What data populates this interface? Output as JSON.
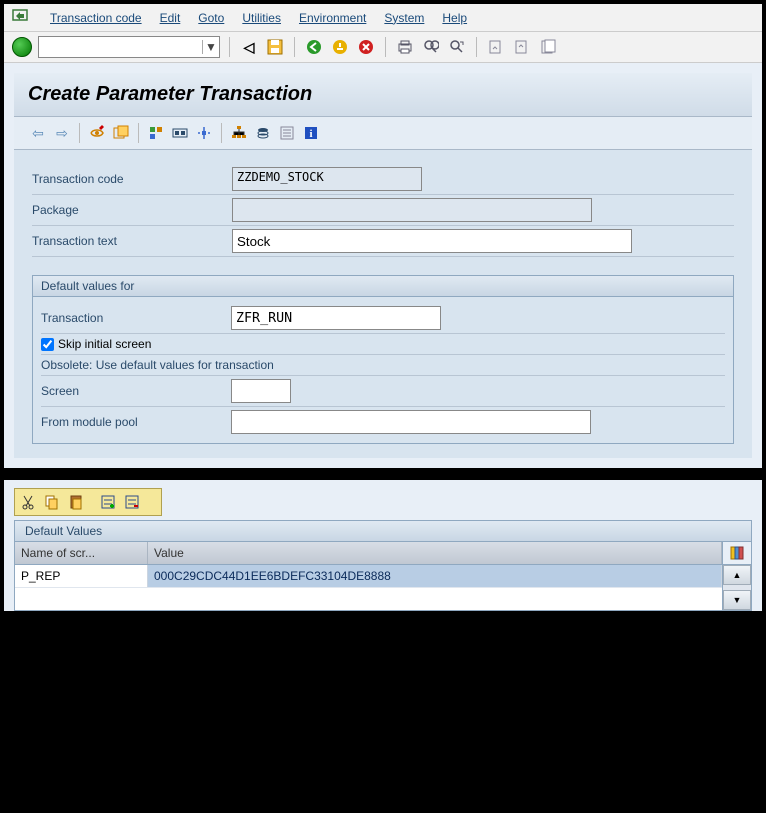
{
  "menu": {
    "items": [
      "Transaction code",
      "Edit",
      "Goto",
      "Utilities",
      "Environment",
      "System",
      "Help"
    ]
  },
  "main_toolbar": {
    "dropdown_value": ""
  },
  "title": "Create Parameter Transaction",
  "form": {
    "tcode_label": "Transaction code",
    "tcode_value": "ZZDEMO_STOCK",
    "package_label": "Package",
    "package_value": "",
    "text_label": "Transaction text",
    "text_value": "Stock"
  },
  "defaults": {
    "group_title": "Default values for",
    "transaction_label": "Transaction",
    "transaction_value": "ZFR_RUN",
    "skip_label": "Skip initial screen",
    "skip_checked": true,
    "obsolete_text": "Obsolete: Use default values for transaction",
    "screen_label": "Screen",
    "screen_value": "",
    "pool_label": "From module pool",
    "pool_value": ""
  },
  "bottom": {
    "panel_title": "Default Values",
    "col1": "Name of scr...",
    "col2": "Value",
    "rows": [
      {
        "name": "P_REP",
        "value": "000C29CDC44D1EE6BDEFC33104DE8888"
      }
    ]
  }
}
